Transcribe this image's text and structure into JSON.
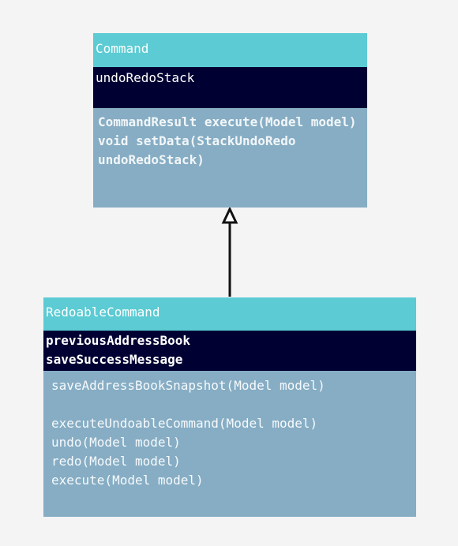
{
  "classes": {
    "command": {
      "name": "Command",
      "attributes": [
        "undoRedoStack"
      ],
      "methods": [
        "CommandResult execute(Model model)",
        "void setData(StackUndoRedo undoRedoStack)"
      ]
    },
    "redoable": {
      "name": "RedoableCommand",
      "attributes": [
        "previousAddressBook",
        "saveSuccessMessage"
      ],
      "methods": [
        "saveAddressBookSnapshot(Model model)",
        "executeUndoableCommand(Model model)",
        "undo(Model model)",
        "redo(Model model)",
        "execute(Model model)"
      ]
    }
  },
  "relationships": [
    {
      "from": "RedoableCommand",
      "to": "Command",
      "type": "inheritance"
    }
  ],
  "colors": {
    "header": "#5ccbd3",
    "attributes": "#000033",
    "methods": "#86adc4",
    "background": "#f4f4f4",
    "line": "#111111"
  }
}
